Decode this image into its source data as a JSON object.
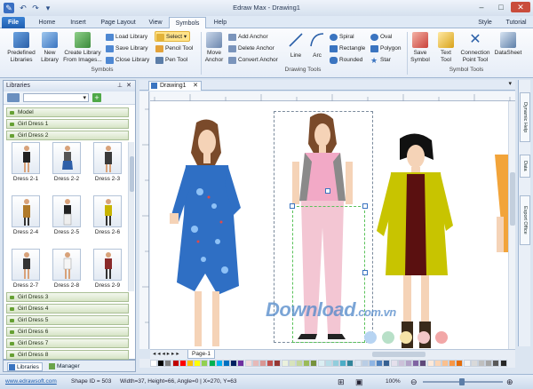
{
  "app": {
    "title": "Edraw Max - Drawing1"
  },
  "quick_access": [
    "undo",
    "redo"
  ],
  "window_buttons": [
    "minimize",
    "maximize",
    "close"
  ],
  "tabs": [
    {
      "label": "File"
    },
    {
      "label": "Home"
    },
    {
      "label": "Insert"
    },
    {
      "label": "Page Layout"
    },
    {
      "label": "View"
    },
    {
      "label": "Symbols"
    },
    {
      "label": "Help"
    }
  ],
  "tabs_right": {
    "style": "Style",
    "tutorial": "Tutorial"
  },
  "ribbon": {
    "symbols_group": {
      "label": "Symbols",
      "predefined_libraries": "Predefined Libraries",
      "new_library": "New Library",
      "create_library": "Create Library From Images...",
      "load_library": "Load Library",
      "save_library": "Save Library",
      "close_library": "Close Library",
      "select": "Select",
      "pencil_tool": "Pencil Tool",
      "pen_tool": "Pen Tool"
    },
    "drawing_tools_group": {
      "label": "Drawing Tools",
      "move_anchor": "Move Anchor",
      "add_anchor": "Add Anchor",
      "delete_anchor": "Delete Anchor",
      "convert_anchor": "Convert Anchor",
      "line": "Line",
      "arc": "Arc",
      "spiral": "Spiral",
      "rectangle": "Rectangle",
      "rounded": "Rounded",
      "oval": "Oval",
      "polygon": "Polygon",
      "star": "Star"
    },
    "symbol_tools_group": {
      "label": "Symbol Tools",
      "save_symbol": "Save Symbol",
      "text_tool": "Text Tool",
      "connection_point_tool": "Connection Point Tool",
      "datasheet": "DataSheet"
    }
  },
  "libraries": {
    "title": "Libraries",
    "categories_top": [
      "Model",
      "Girl Dress 1",
      "Girl Dress 2"
    ],
    "shapes": [
      "Dress 2-1",
      "Dress 2-2",
      "Dress 2-3",
      "Dress 2-4",
      "Dress 2-5",
      "Dress 2-6",
      "Dress 2-7",
      "Dress 2-8",
      "Dress 2-9"
    ],
    "categories_bottom": [
      "Girl Dress 3",
      "Girl Dress 4",
      "Girl Dress 5",
      "Girl Dress 6",
      "Girl Dress 7",
      "Girl Dress 8"
    ],
    "bottom_tabs": [
      "Libraries",
      "Manager"
    ]
  },
  "document": {
    "tab": "Drawing1",
    "page_tab": "Page-1"
  },
  "right_dock": [
    "Dynamic Help",
    "Data",
    "Export Office"
  ],
  "watermark": {
    "main": "Download",
    "tld": ".com.vn"
  },
  "colors": {
    "accent": "#1f5fb0",
    "palette": [
      "#ffffff",
      "#000000",
      "#7f7f7f",
      "#c00000",
      "#ff0000",
      "#ffc000",
      "#ffff00",
      "#92d050",
      "#00b050",
      "#00b0f0",
      "#0070c0",
      "#002060",
      "#7030a0",
      "#f2dcdb",
      "#e6b9b8",
      "#d99694",
      "#c0504d",
      "#953734",
      "#ebf1dd",
      "#d7e3bc",
      "#c3d69b",
      "#9bbb59",
      "#76923c",
      "#dbeef3",
      "#b7dde8",
      "#92cddc",
      "#4bacc6",
      "#31859b",
      "#dce6f2",
      "#b9cde5",
      "#8eb4e3",
      "#4f81bd",
      "#366092",
      "#e5e0ec",
      "#ccc1d9",
      "#b2a2c7",
      "#8064a2",
      "#5f497a",
      "#fde9d9",
      "#fbd5b5",
      "#fac08f",
      "#f79646",
      "#e36c09",
      "#f2f2f2",
      "#d9d9d9",
      "#bfbfbf",
      "#a6a6a6",
      "#595959",
      "#262626"
    ]
  },
  "status": {
    "website": "www.edrawsoft.com",
    "shape_id": "Shape ID = 503",
    "geometry": "Width=37, Height=66, Angle=0 | X=270, Y=63",
    "zoom": "100%"
  }
}
